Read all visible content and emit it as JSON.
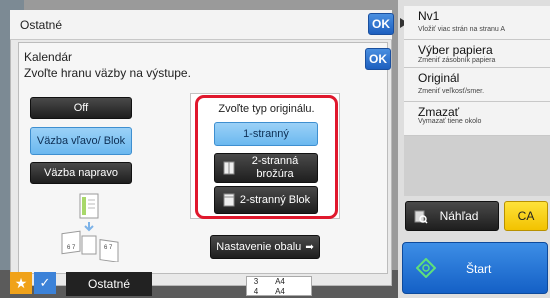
{
  "outer": {
    "title": "Ostatné",
    "ok_label": "OK"
  },
  "inner": {
    "title": "Kalendár",
    "subtitle": "Zvoľte hranu väzby na výstupe.",
    "ok_label": "OK"
  },
  "binding": {
    "off_label": "Off",
    "left_label": "Väzba vľavo/ Blok",
    "right_label": "Väzba napravo",
    "selected": "left"
  },
  "original_type": {
    "title": "Zvoľte typ originálu.",
    "one_sided_label": "1-stranný",
    "two_sided_booklet_label": "2-stranná brožúra",
    "two_sided_pad_label": "2-stranný Blok",
    "selected": "1-stranný"
  },
  "cover_button_label": "Nastavenie obalu",
  "bottom": {
    "tab_label": "Ostatné",
    "tray_rows": [
      {
        "num": "3",
        "size": "A4"
      },
      {
        "num": "4",
        "size": "A4"
      }
    ]
  },
  "right_menu": {
    "items": [
      {
        "title": "Nv1",
        "subtitle": "Vložiť viac strán na stranu A"
      },
      {
        "title": "Výber papiera",
        "subtitle": "Zmeniť zásobník papiera"
      },
      {
        "title": "Originál",
        "subtitle": "Zmeniť veľkosť/smer."
      },
      {
        "title": "Zmazať",
        "subtitle": "Vymazať tiene okolo"
      }
    ]
  },
  "actions": {
    "preview_label": "Náhľad",
    "ca_label": "CA",
    "start_label": "Štart"
  },
  "colors": {
    "highlight": "#e0182d",
    "selected_fill": "#7fc2f2",
    "ok_blue": "#2b6fd0"
  }
}
